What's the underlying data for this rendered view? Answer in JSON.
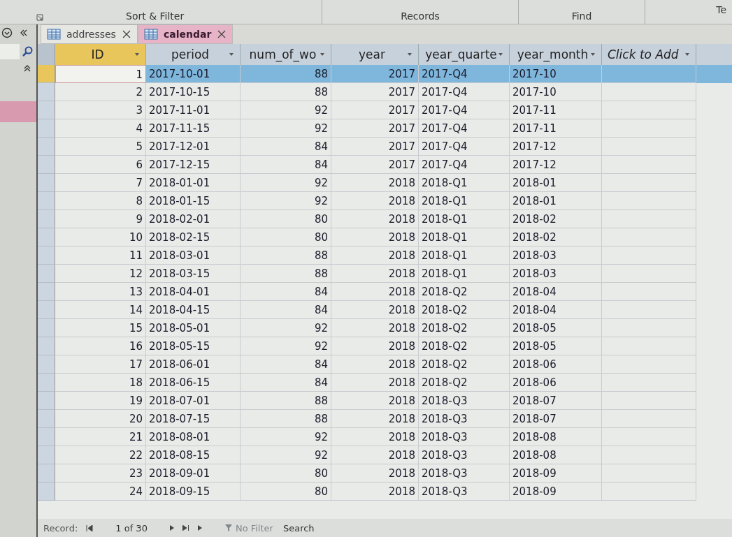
{
  "ribbon": {
    "groups": [
      {
        "label": "Sort & Filter"
      },
      {
        "label": "Records"
      },
      {
        "label": "Find"
      },
      {
        "label": "Te"
      }
    ]
  },
  "tabs": [
    {
      "label": "addresses",
      "selected": false
    },
    {
      "label": "calendar",
      "selected": true
    }
  ],
  "table": {
    "columns": [
      {
        "label": "ID"
      },
      {
        "label": "period"
      },
      {
        "label": "num_of_wo"
      },
      {
        "label": "year"
      },
      {
        "label": "year_quarte"
      },
      {
        "label": "year_month"
      },
      {
        "label": "Click to Add"
      }
    ],
    "rows": [
      {
        "selected": true,
        "cells": [
          "1",
          "2017-10-01",
          "88",
          "2017",
          "2017-Q4",
          "2017-10"
        ]
      },
      {
        "selected": false,
        "cells": [
          "2",
          "2017-10-15",
          "88",
          "2017",
          "2017-Q4",
          "2017-10"
        ]
      },
      {
        "selected": false,
        "cells": [
          "3",
          "2017-11-01",
          "92",
          "2017",
          "2017-Q4",
          "2017-11"
        ]
      },
      {
        "selected": false,
        "cells": [
          "4",
          "2017-11-15",
          "92",
          "2017",
          "2017-Q4",
          "2017-11"
        ]
      },
      {
        "selected": false,
        "cells": [
          "5",
          "2017-12-01",
          "84",
          "2017",
          "2017-Q4",
          "2017-12"
        ]
      },
      {
        "selected": false,
        "cells": [
          "6",
          "2017-12-15",
          "84",
          "2017",
          "2017-Q4",
          "2017-12"
        ]
      },
      {
        "selected": false,
        "cells": [
          "7",
          "2018-01-01",
          "92",
          "2018",
          "2018-Q1",
          "2018-01"
        ]
      },
      {
        "selected": false,
        "cells": [
          "8",
          "2018-01-15",
          "92",
          "2018",
          "2018-Q1",
          "2018-01"
        ]
      },
      {
        "selected": false,
        "cells": [
          "9",
          "2018-02-01",
          "80",
          "2018",
          "2018-Q1",
          "2018-02"
        ]
      },
      {
        "selected": false,
        "cells": [
          "10",
          "2018-02-15",
          "80",
          "2018",
          "2018-Q1",
          "2018-02"
        ]
      },
      {
        "selected": false,
        "cells": [
          "11",
          "2018-03-01",
          "88",
          "2018",
          "2018-Q1",
          "2018-03"
        ]
      },
      {
        "selected": false,
        "cells": [
          "12",
          "2018-03-15",
          "88",
          "2018",
          "2018-Q1",
          "2018-03"
        ]
      },
      {
        "selected": false,
        "cells": [
          "13",
          "2018-04-01",
          "84",
          "2018",
          "2018-Q2",
          "2018-04"
        ]
      },
      {
        "selected": false,
        "cells": [
          "14",
          "2018-04-15",
          "84",
          "2018",
          "2018-Q2",
          "2018-04"
        ]
      },
      {
        "selected": false,
        "cells": [
          "15",
          "2018-05-01",
          "92",
          "2018",
          "2018-Q2",
          "2018-05"
        ]
      },
      {
        "selected": false,
        "cells": [
          "16",
          "2018-05-15",
          "92",
          "2018",
          "2018-Q2",
          "2018-05"
        ]
      },
      {
        "selected": false,
        "cells": [
          "17",
          "2018-06-01",
          "84",
          "2018",
          "2018-Q2",
          "2018-06"
        ]
      },
      {
        "selected": false,
        "cells": [
          "18",
          "2018-06-15",
          "84",
          "2018",
          "2018-Q2",
          "2018-06"
        ]
      },
      {
        "selected": false,
        "cells": [
          "19",
          "2018-07-01",
          "88",
          "2018",
          "2018-Q3",
          "2018-07"
        ]
      },
      {
        "selected": false,
        "cells": [
          "20",
          "2018-07-15",
          "88",
          "2018",
          "2018-Q3",
          "2018-07"
        ]
      },
      {
        "selected": false,
        "cells": [
          "21",
          "2018-08-01",
          "92",
          "2018",
          "2018-Q3",
          "2018-08"
        ]
      },
      {
        "selected": false,
        "cells": [
          "22",
          "2018-08-15",
          "92",
          "2018",
          "2018-Q3",
          "2018-08"
        ]
      },
      {
        "selected": false,
        "cells": [
          "23",
          "2018-09-01",
          "80",
          "2018",
          "2018-Q3",
          "2018-09"
        ]
      },
      {
        "selected": false,
        "cells": [
          "24",
          "2018-09-15",
          "80",
          "2018",
          "2018-Q3",
          "2018-09"
        ]
      }
    ]
  },
  "status_bar": {
    "record_label": "Record:",
    "position": "1 of 30",
    "filter": {
      "label": "No Filter",
      "disabled": true
    },
    "search": {
      "placeholder": "Search"
    }
  }
}
